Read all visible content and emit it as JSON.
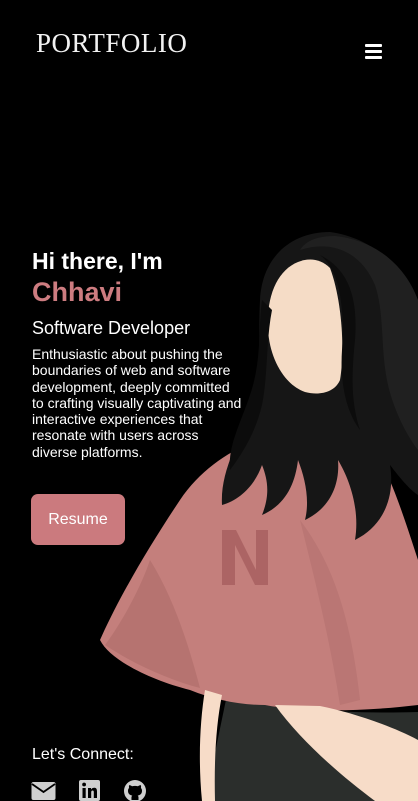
{
  "header": {
    "logo": "PORTFOLIO",
    "menu_icon": "hamburger-menu-icon"
  },
  "hero": {
    "greeting": "Hi there, I'm",
    "name": "Chhavi",
    "role": "Software Developer",
    "description": "Enthusiastic about pushing the boundaries of web and software development, deeply committed to crafting visually captivating and interactive experiences that resonate with users across diverse platforms.",
    "resume_label": "Resume"
  },
  "connect": {
    "label": "Let's Connect:",
    "links": [
      {
        "icon": "envelope-icon"
      },
      {
        "icon": "linkedin-icon"
      },
      {
        "icon": "github-icon"
      }
    ]
  },
  "colors": {
    "background": "#000000",
    "accent": "#cd7c80",
    "button": "#cb7a7e",
    "text": "#ffffff"
  }
}
